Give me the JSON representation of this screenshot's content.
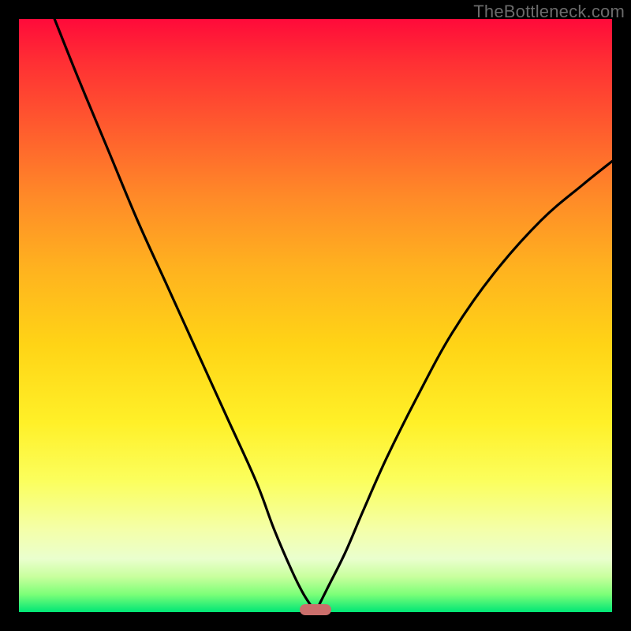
{
  "watermark": "TheBottleneck.com",
  "colors": {
    "background": "#000000",
    "curve": "#000000",
    "marker": "#cb6e6b"
  },
  "chart_data": {
    "type": "line",
    "title": "",
    "xlabel": "",
    "ylabel": "",
    "xlim": [
      0,
      100
    ],
    "ylim": [
      0,
      100
    ],
    "grid": false,
    "legend": false,
    "series": [
      {
        "name": "left-curve",
        "x": [
          6,
          10,
          15,
          20,
          25,
          30,
          35,
          40,
          43,
          46,
          48,
          50
        ],
        "y": [
          100,
          90,
          78,
          66,
          55,
          44,
          33,
          22,
          14,
          7,
          3,
          0
        ]
      },
      {
        "name": "right-curve",
        "x": [
          50,
          52,
          55,
          58,
          62,
          67,
          73,
          80,
          88,
          95,
          100
        ],
        "y": [
          0,
          4,
          10,
          17,
          26,
          36,
          47,
          57,
          66,
          72,
          76
        ]
      }
    ],
    "marker": {
      "x": 50,
      "y": 0,
      "shape": "pill"
    },
    "gradient_stops": [
      {
        "pos": 0,
        "color": "#ff0a3a"
      },
      {
        "pos": 18,
        "color": "#ff5a2e"
      },
      {
        "pos": 42,
        "color": "#ffb21f"
      },
      {
        "pos": 68,
        "color": "#fff028"
      },
      {
        "pos": 86,
        "color": "#f4ffa8"
      },
      {
        "pos": 97,
        "color": "#7dff78"
      },
      {
        "pos": 100,
        "color": "#00e676"
      }
    ]
  }
}
